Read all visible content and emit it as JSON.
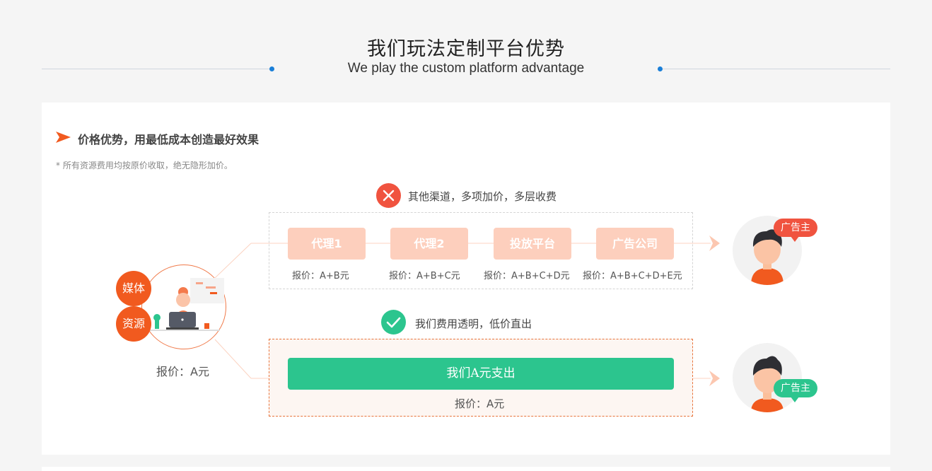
{
  "header": {
    "title": "我们玩法定制平台优势",
    "subtitle": "We play the custom platform advantage"
  },
  "section": {
    "title": "价格优势，用最低成本创造最好效果",
    "note": "* 所有资源费用均按原价收取，绝无隐形加价。"
  },
  "other_channels": {
    "label": "其他渠道，多项加价，多层收费",
    "chips": [
      "代理1",
      "代理2",
      "投放平台",
      "广告公司"
    ],
    "prices": [
      "报价：A+B元",
      "报价：A+B+C元",
      "报价：A+B+C+D元",
      "报价：A+B+C+D+E元"
    ]
  },
  "ours": {
    "label": "我们费用透明，低价直出",
    "button": "我们A元支出",
    "price": "报价：A元"
  },
  "media": {
    "badge1": "媒体",
    "badge2": "资源",
    "price": "报价：A元"
  },
  "advertiser": {
    "top_label": "广告主",
    "bottom_label": "广告主"
  },
  "colors": {
    "accent_orange": "#f15a1f",
    "red": "#f0533f",
    "green": "#2cc58e",
    "chip_peach": "#fdcfbd",
    "blue_dot": "#1a7fd8"
  }
}
